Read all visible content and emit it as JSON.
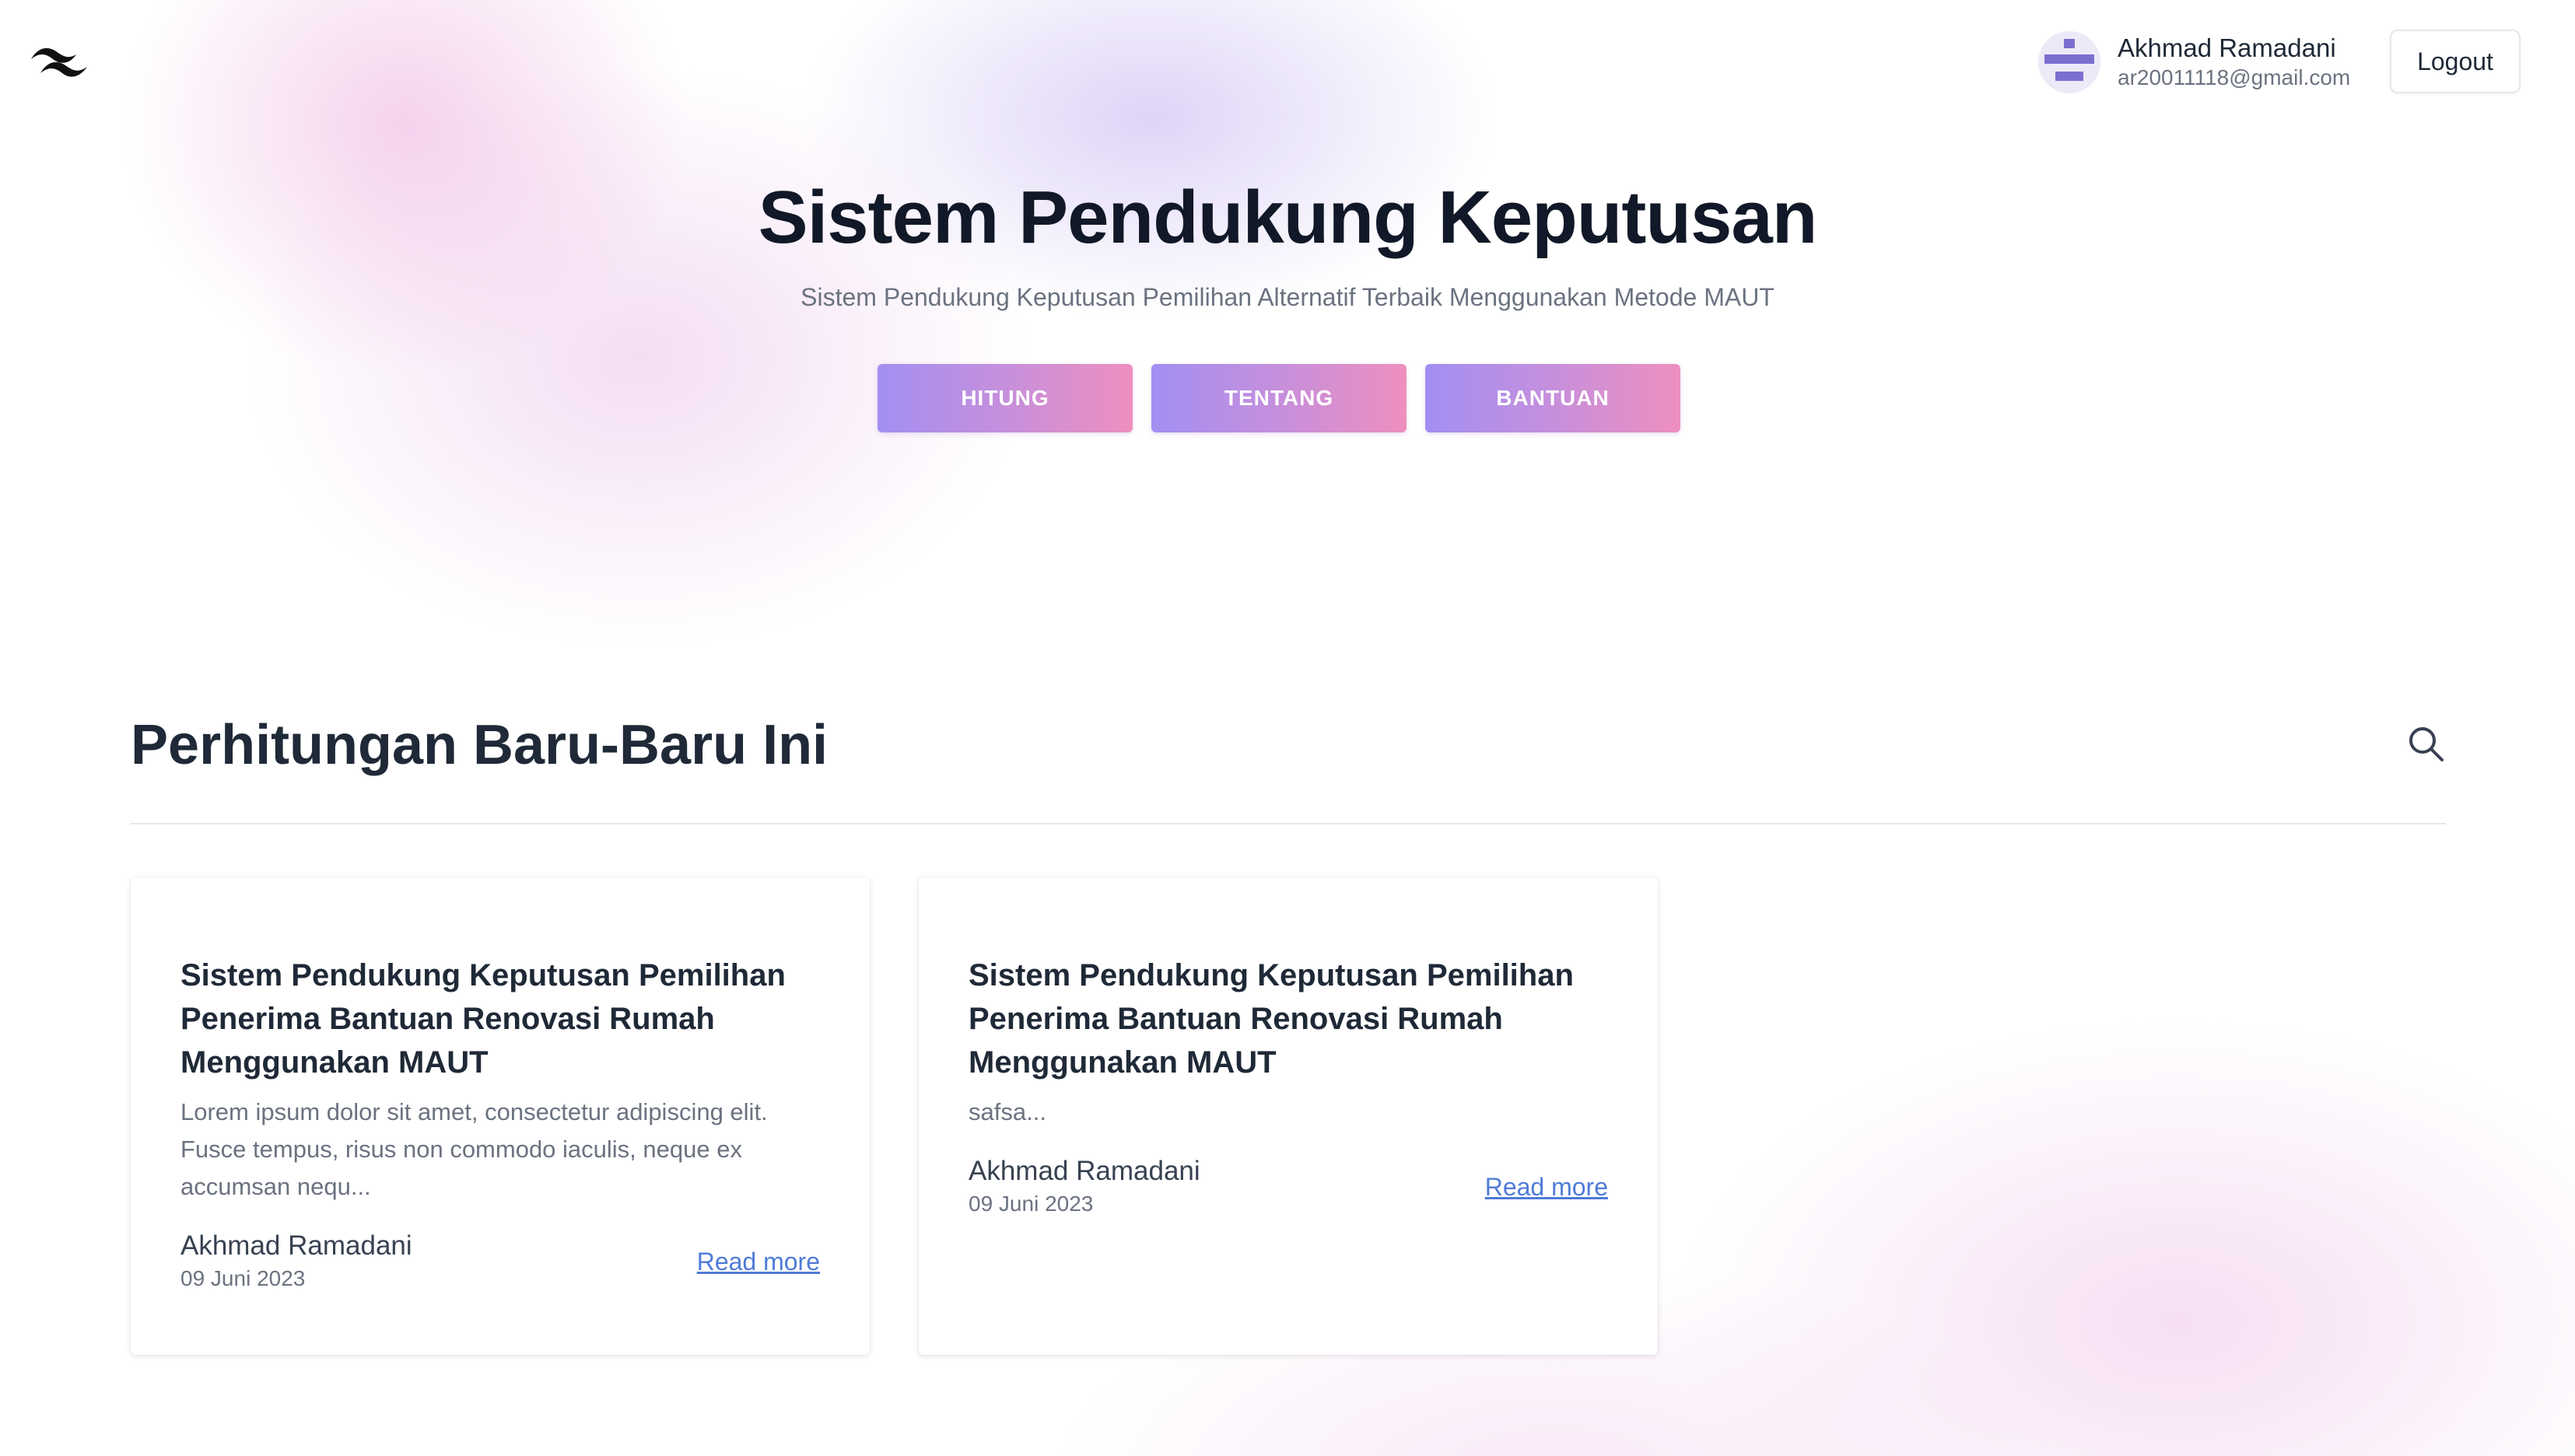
{
  "header": {
    "logo_icon": "tailwind-wave-icon",
    "user": {
      "avatar_icon": "identicon-avatar",
      "name": "Akhmad Ramadani",
      "email": "ar20011118@gmail.com"
    },
    "logout_label": "Logout"
  },
  "hero": {
    "title": "Sistem Pendukung Keputusan",
    "subtitle": "Sistem Pendukung Keputusan Pemilihan Alternatif Terbaik Menggunakan Metode MAUT",
    "buttons": [
      {
        "label": "HITUNG"
      },
      {
        "label": "TENTANG"
      },
      {
        "label": "BANTUAN"
      }
    ]
  },
  "recent": {
    "title": "Perhitungan Baru-Baru Ini",
    "search_icon": "search-icon",
    "cards": [
      {
        "title": "Sistem Pendukung Keputusan Pemilihan Penerima Bantuan Renovasi Rumah Menggunakan MAUT",
        "excerpt": "Lorem ipsum dolor sit amet, consectetur adipiscing elit. Fusce tempus, risus non commodo iaculis, neque ex accumsan nequ...",
        "author": "Akhmad Ramadani",
        "date": "09 Juni 2023",
        "link_label": "Read more"
      },
      {
        "title": "Sistem Pendukung Keputusan Pemilihan Penerima Bantuan Renovasi Rumah Menggunakan MAUT",
        "excerpt": "safsa...",
        "author": "Akhmad Ramadani",
        "date": "09 Juni 2023",
        "link_label": "Read more"
      }
    ]
  },
  "colors": {
    "button_gradient_start": "#a28ff2",
    "button_gradient_end": "#ee8fbe",
    "link": "#4f7bd8",
    "avatar_accent": "#7b6fd0"
  }
}
